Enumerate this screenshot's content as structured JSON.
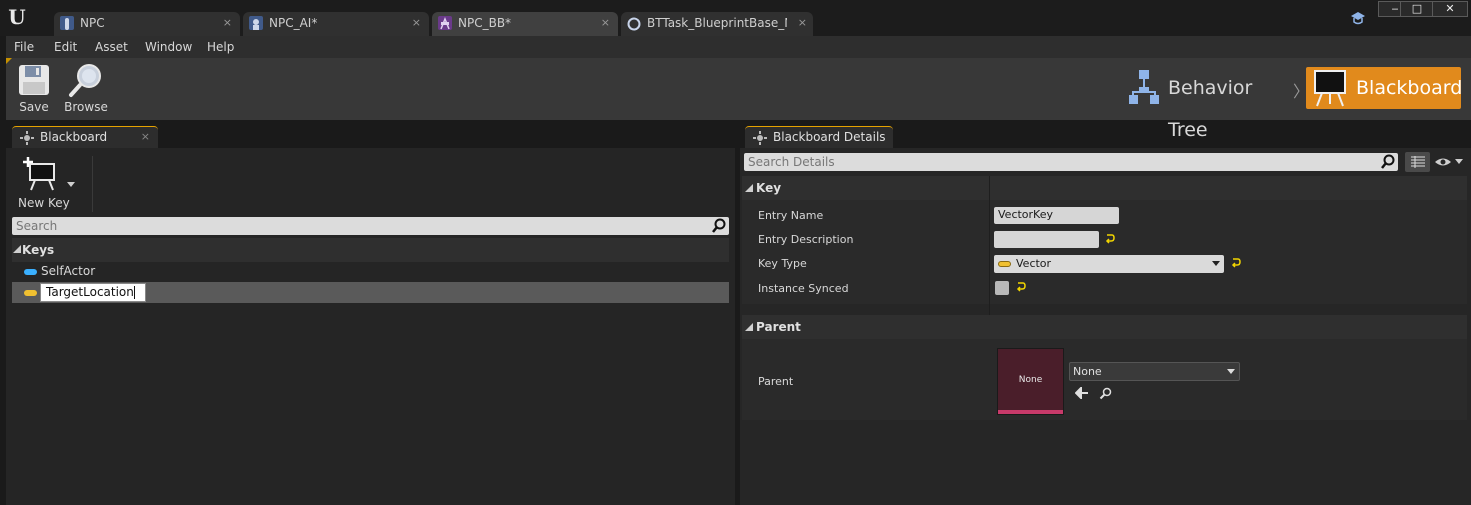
{
  "titlebar": {
    "tabs": [
      {
        "label": "NPC",
        "icon": "npc-blueprint-icon"
      },
      {
        "label": "NPC_AI*",
        "icon": "ai-controller-icon"
      },
      {
        "label": "NPC_BB*",
        "icon": "blackboard-asset-icon"
      },
      {
        "label": "BTTask_BlueprintBase_N*",
        "icon": "bttask-blueprint-icon"
      }
    ],
    "close_glyph": "×",
    "window_buttons": {
      "minimize": "‒",
      "maximize": "□",
      "close": "✕"
    }
  },
  "menu": [
    "File",
    "Edit",
    "Asset",
    "Window",
    "Help"
  ],
  "toolbar": {
    "save_label": "Save",
    "browse_label": "Browse",
    "mode_behavior_tree": "Behavior Tree",
    "mode_separator": "〉",
    "mode_blackboard": "Blackboard"
  },
  "blackboard_panel": {
    "tab_label": "Blackboard",
    "new_key_label": "New Key",
    "search_placeholder": "Search",
    "keys_header": "Keys",
    "keys": [
      {
        "name": "SelfActor",
        "type_color": "#3ab0ff"
      },
      {
        "name": "TargetLocation",
        "type_color": "#f0c030",
        "selected": true,
        "editing": true
      }
    ]
  },
  "details_panel": {
    "tab_label": "Blackboard Details",
    "search_placeholder": "Search Details",
    "key_section": "Key",
    "entry_name_label": "Entry Name",
    "entry_name_value": "VectorKey",
    "entry_description_label": "Entry Description",
    "entry_description_value": "",
    "key_type_label": "Key Type",
    "key_type_value": "Vector",
    "instance_synced_label": "Instance Synced",
    "instance_synced_checked": false,
    "parent_section": "Parent",
    "parent_label": "Parent",
    "parent_thumbnail_text": "None",
    "parent_value": "None"
  },
  "colors": {
    "accent_orange": "#e18a1c",
    "tab_underline": "#e6a300",
    "vector_pill": "#f0c030",
    "object_pill": "#3ab0ff",
    "parent_thumbnail": "#4a1e2a"
  }
}
